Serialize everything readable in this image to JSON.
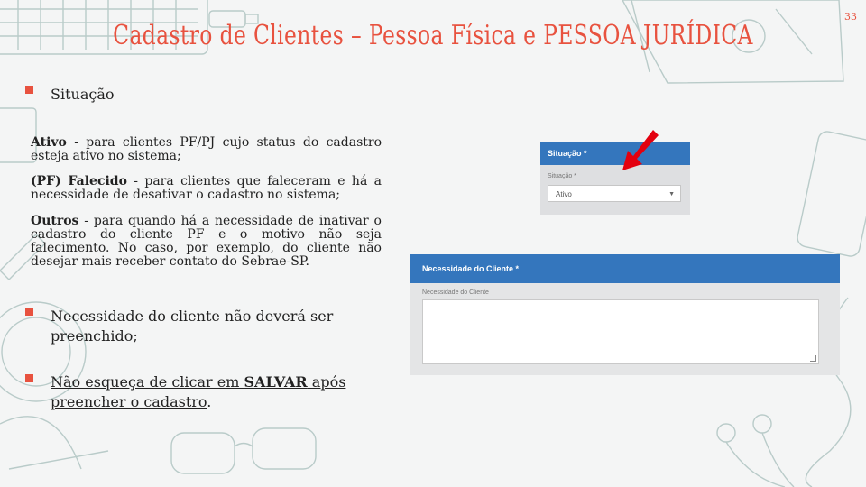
{
  "slide": {
    "title": "Cadastro de Clientes – Pessoa Física e PESSOA JURÍDICA",
    "page_number": "33",
    "accent_color": "#e8523f"
  },
  "bullets": {
    "situacao": "Situação",
    "ativo_term": "Ativo",
    "ativo_text": " - para clientes PF/PJ cujo status do cadastro esteja ativo no sistema;",
    "falecido_term": "(PF) Falecido",
    "falecido_text": " - para clientes que faleceram e há a necessidade de desativar o cadastro no sistema;",
    "outros_term": "Outros",
    "outros_text": " - para quando há a necessidade de inativar o cadastro do cliente PF e o motivo não seja falecimento. No caso, por exemplo, do cliente não desejar mais receber contato do Sebrae-SP.",
    "necessidade": "Necessidade do cliente não deverá ser preenchido;",
    "salvar_pre": "Não esqueça de clicar em ",
    "salvar_bold": "SALVAR",
    "salvar_post": " após preencher o cadastro",
    "salvar_end": "."
  },
  "form_situacao": {
    "header": "Situação *",
    "label": "Situação *",
    "selected": "Ativo",
    "header_color": "#3476bd",
    "arrow_color": "#e3000f"
  },
  "form_necessidade": {
    "header": "Necessidade do Cliente *",
    "label": "Necessidade do Cliente",
    "value": ""
  }
}
